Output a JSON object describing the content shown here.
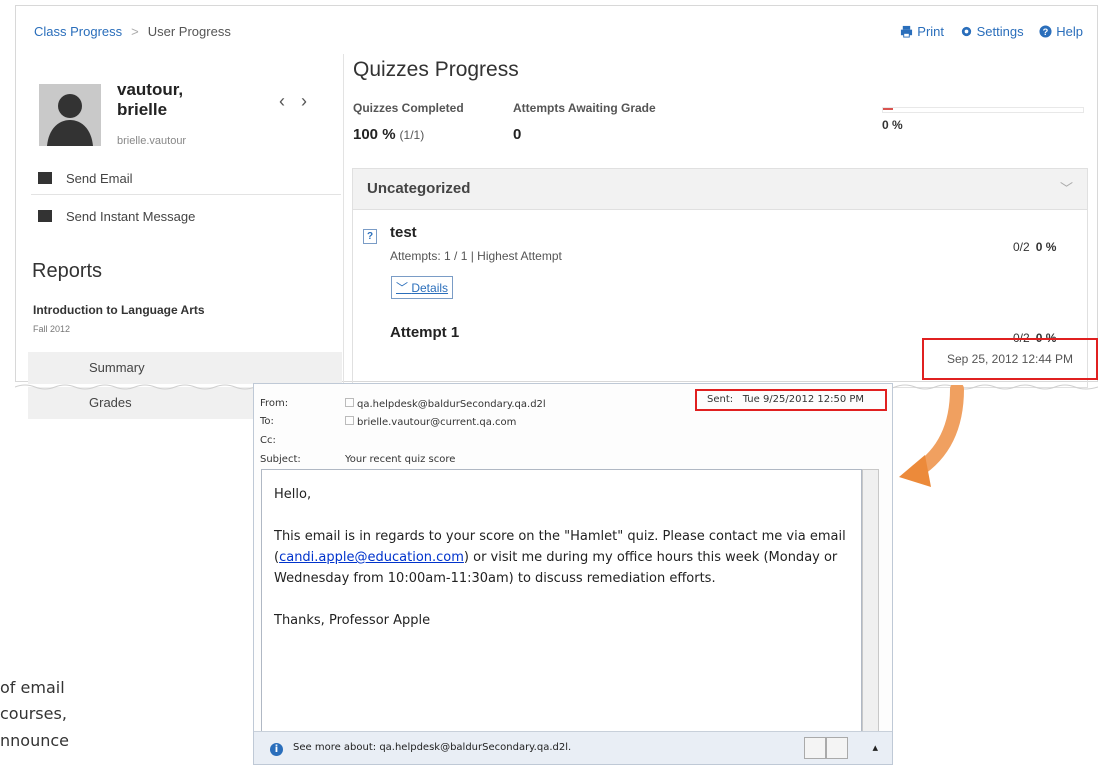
{
  "breadcrumb": {
    "item1": "Class Progress",
    "item2": "User Progress"
  },
  "toplinks": {
    "print": "Print",
    "settings": "Settings",
    "help": "Help"
  },
  "user": {
    "name": "vautour, brielle",
    "login": "brielle.vautour"
  },
  "side": {
    "send_email": "Send Email",
    "send_im": "Send Instant Message",
    "reports_title": "Reports",
    "course": "Introduction to Language Arts",
    "term": "Fall 2012",
    "menu": [
      "Summary",
      "Grades"
    ]
  },
  "quizzes": {
    "title": "Quizzes Progress",
    "completed_label": "Quizzes Completed",
    "completed_value": "100 %",
    "completed_detail": "(1/1)",
    "awaiting_label": "Attempts Awaiting Grade",
    "awaiting_value": "0",
    "progress_pct": "0 %",
    "progress_fraction": 0.05,
    "category": "Uncategorized",
    "quiz_name": "test",
    "quiz_meta": "Attempts: 1 / 1 | Highest Attempt",
    "details": "Details",
    "quiz_score": "0/2",
    "quiz_pct": "0 %",
    "attempt_title": "Attempt 1",
    "attempt_score": "0/2",
    "attempt_pct": "0 %",
    "attempt_date": "Sep 25, 2012 12:44 PM"
  },
  "email": {
    "from_label": "From:",
    "from": "qa.helpdesk@baldurSecondary.qa.d2l",
    "to_label": "To:",
    "to": "brielle.vautour@current.qa.com",
    "cc_label": "Cc:",
    "subject_label": "Subject:",
    "subject": "Your recent quiz score",
    "sent_label": "Sent:",
    "sent": "Tue 9/25/2012 12:50 PM",
    "greeting": "Hello,",
    "body_pre": "This email is in regards to your score on the \"Hamlet\" quiz. Please contact me via email (",
    "body_link": "candi.apple@education.com",
    "body_post": ") or visit me during my office hours this week (Monday or Wednesday from 10:00am-11:30am) to discuss remediation efforts.",
    "signoff": "Thanks, Professor Apple",
    "footer": "See more about: qa.helpdesk@baldurSecondary.qa.d2l."
  },
  "partial_text": [
    "of  email",
    " courses,",
    "nnounce"
  ]
}
